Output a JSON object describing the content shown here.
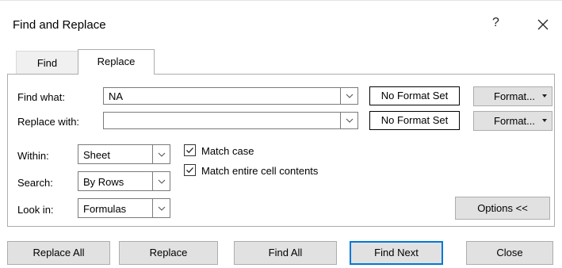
{
  "window": {
    "title": "Find and Replace",
    "help": "?"
  },
  "tabs": [
    {
      "label": "Find",
      "active": false
    },
    {
      "label": "Replace",
      "active": true
    }
  ],
  "find": {
    "label": "Find what:",
    "value": "NA",
    "format_status": "No Format Set",
    "format_button": "Format..."
  },
  "replace": {
    "label": "Replace with:",
    "value": "",
    "format_status": "No Format Set",
    "format_button": "Format..."
  },
  "options": {
    "within": {
      "label": "Within:",
      "value": "Sheet"
    },
    "search": {
      "label": "Search:",
      "value": "By Rows"
    },
    "look_in": {
      "label": "Look in:",
      "value": "Formulas"
    },
    "match_case": {
      "label": "Match case",
      "checked": true
    },
    "match_entire": {
      "label": "Match entire cell contents",
      "checked": true
    },
    "toggle_button": "Options <<"
  },
  "buttons": {
    "replace_all": "Replace All",
    "replace": "Replace",
    "find_all": "Find All",
    "find_next": "Find Next",
    "close": "Close"
  },
  "colors": {
    "accent": "#0078d7",
    "button_bg": "#e1e1e1",
    "tab_inactive_bg": "#f0f0f0"
  }
}
